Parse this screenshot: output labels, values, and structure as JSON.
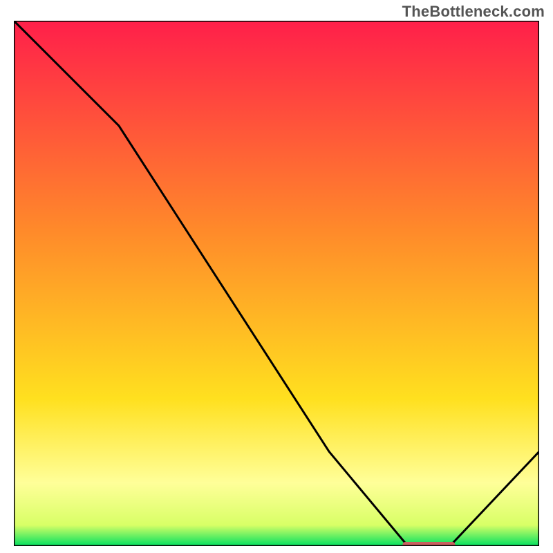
{
  "watermark": "TheBottleneck.com",
  "colors": {
    "gradient_top": "#ff1f4a",
    "gradient_mid1": "#ff8a2a",
    "gradient_mid2": "#ffe01f",
    "gradient_band": "#ffff99",
    "gradient_bottom": "#00e060",
    "curve": "#000000",
    "marker": "#c86060",
    "frame": "#000000"
  },
  "chart_data": {
    "type": "line",
    "title": "",
    "xlabel": "",
    "ylabel": "",
    "xlim": [
      0,
      100
    ],
    "ylim": [
      0,
      100
    ],
    "series": [
      {
        "name": "bottleneck-curve",
        "x": [
          0,
          20,
          60,
          75,
          83,
          100
        ],
        "y": [
          100,
          80,
          18,
          0,
          0,
          18
        ]
      }
    ],
    "marker": {
      "name": "optimal-range",
      "x_start": 74,
      "x_end": 84,
      "y": 0
    },
    "gradient_stops": [
      {
        "offset": 0.0,
        "color": "#ff1f4a"
      },
      {
        "offset": 0.4,
        "color": "#ff8a2a"
      },
      {
        "offset": 0.72,
        "color": "#ffe01f"
      },
      {
        "offset": 0.88,
        "color": "#ffff99"
      },
      {
        "offset": 0.96,
        "color": "#d8ff66"
      },
      {
        "offset": 1.0,
        "color": "#00e060"
      }
    ]
  }
}
